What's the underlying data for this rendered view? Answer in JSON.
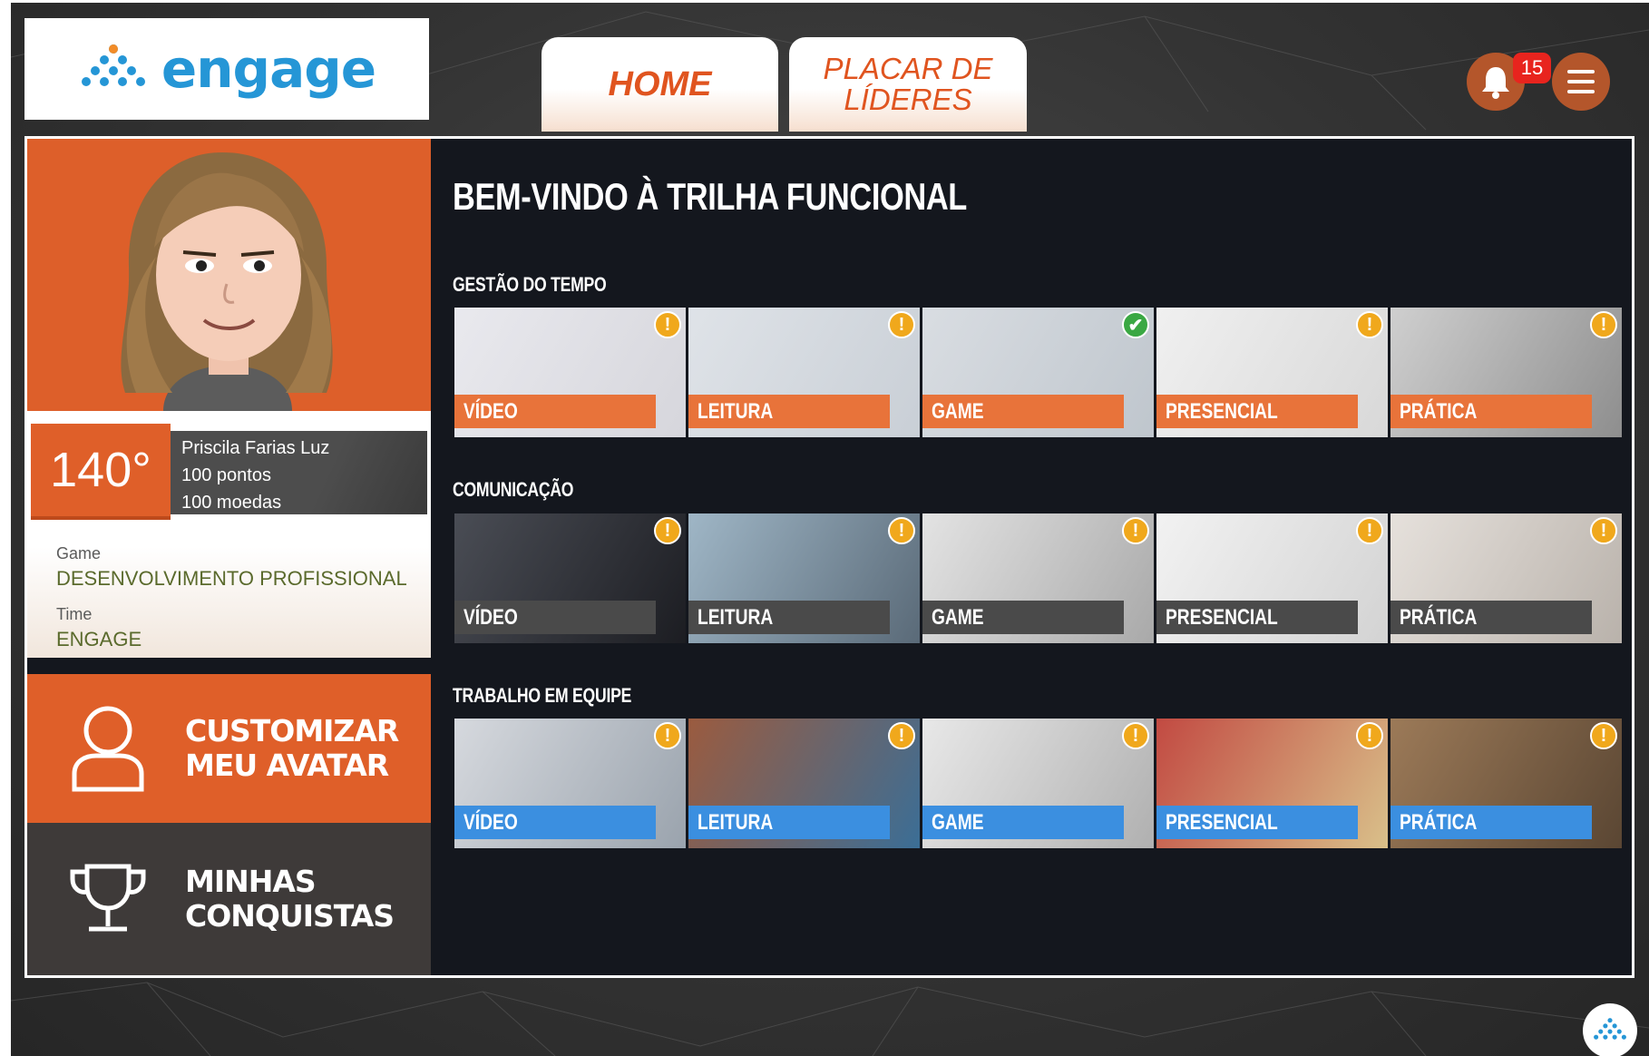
{
  "brand": {
    "name": "engage",
    "color": "#2596d6"
  },
  "tabs": [
    {
      "label": "HOME",
      "active": true
    },
    {
      "label": "PLACAR DE LÍDERES",
      "active": false
    }
  ],
  "notifications": {
    "count": "15",
    "icon": "bell-icon"
  },
  "menu": {
    "icon": "hamburger-menu-icon"
  },
  "profile": {
    "position": "140°",
    "name": "Priscila Farias Luz",
    "points": "100 pontos",
    "coins": "100 moedas",
    "game_label": "Game",
    "game_value": "DESENVOLVIMENTO PROFISSIONAL",
    "time_label": "Time",
    "time_value": "ENGAGE"
  },
  "actions": {
    "customize": "CUSTOMIZAR\nMEU AVATAR",
    "achievements": "MINHAS\nCONQUISTAS"
  },
  "main": {
    "welcome": "BEM-VINDO À TRILHA FUNCIONAL",
    "sections": [
      {
        "title": "GESTÃO DO TEMPO",
        "label_color": "#e8733a",
        "cards": [
          {
            "label": "VÍDEO",
            "status": "pending"
          },
          {
            "label": "LEITURA",
            "status": "pending"
          },
          {
            "label": "GAME",
            "status": "done"
          },
          {
            "label": "PRESENCIAL",
            "status": "pending"
          },
          {
            "label": "PRÁTICA",
            "status": "pending"
          }
        ]
      },
      {
        "title": "COMUNICAÇÃO",
        "label_color": "#4a4a4a",
        "cards": [
          {
            "label": "VÍDEO",
            "status": "pending"
          },
          {
            "label": "LEITURA",
            "status": "pending"
          },
          {
            "label": "GAME",
            "status": "pending"
          },
          {
            "label": "PRESENCIAL",
            "status": "pending"
          },
          {
            "label": "PRÁTICA",
            "status": "pending"
          }
        ]
      },
      {
        "title": "TRABALHO EM EQUIPE",
        "label_color": "#3b8fe0",
        "cards": [
          {
            "label": "VÍDEO",
            "status": "pending"
          },
          {
            "label": "LEITURA",
            "status": "pending"
          },
          {
            "label": "GAME",
            "status": "pending"
          },
          {
            "label": "PRESENCIAL",
            "status": "pending"
          },
          {
            "label": "PRÁTICA",
            "status": "pending"
          }
        ]
      }
    ]
  }
}
